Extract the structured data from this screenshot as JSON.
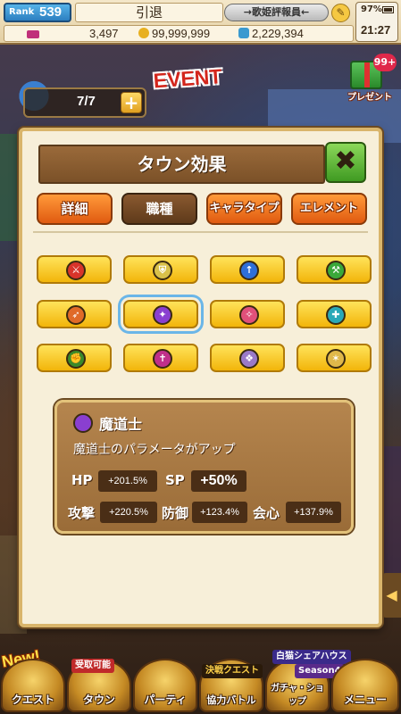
{
  "status": {
    "rank_label": "Rank",
    "rank_value": "539",
    "player_name": "引退",
    "title_badge": "→歌姫評報員←",
    "battery_pct": "97%",
    "clock": "21:27",
    "gems": "3,497",
    "gold": "99,999,999",
    "potion": "2,229,394"
  },
  "hud": {
    "stamina": "7/7",
    "stamina_plus": "+",
    "event_sign": "EVENT",
    "present_badge": "99+",
    "present_label": "プレゼント"
  },
  "panel": {
    "title": "タウン効果",
    "close_label": "✖",
    "tabs": [
      {
        "label": "詳細",
        "active": false
      },
      {
        "label": "職種",
        "active": true
      },
      {
        "label": "キャラタイプ",
        "active": false
      },
      {
        "label": "エレメント",
        "active": false
      }
    ],
    "classes": [
      {
        "icon": "swordsman-icon",
        "color": "#d8342a",
        "glyph": "⚔"
      },
      {
        "icon": "shield-knight-icon",
        "color": "#d9c14a",
        "glyph": "⛨"
      },
      {
        "icon": "lancer-icon",
        "color": "#2f6fd8",
        "glyph": "↑"
      },
      {
        "icon": "axe-icon",
        "color": "#3aa83a",
        "glyph": "⚒"
      },
      {
        "icon": "archer-icon",
        "color": "#e06a28",
        "glyph": "➶"
      },
      {
        "icon": "mage-icon",
        "color": "#8a3fd0",
        "glyph": "✦"
      },
      {
        "icon": "thief-icon",
        "color": "#e0507a",
        "glyph": "✧"
      },
      {
        "icon": "gunner-icon",
        "color": "#2aa8b8",
        "glyph": "✚"
      },
      {
        "icon": "fighter-icon",
        "color": "#3a8a2a",
        "glyph": "✊"
      },
      {
        "icon": "cleric-icon",
        "color": "#c0308a",
        "glyph": "✝"
      },
      {
        "icon": "dragon-icon",
        "color": "#9a7ac8",
        "glyph": "❖"
      },
      {
        "icon": "beast-icon",
        "color": "#e0b84a",
        "glyph": "✶"
      }
    ],
    "selected_index": 5,
    "detail": {
      "name": "魔道士",
      "description": "魔道士のパラメータがアップ",
      "hp_label": "HP",
      "hp_value": "+201.5%",
      "sp_label": "SP",
      "sp_value": "+50%",
      "atk_label": "攻撃",
      "atk_value": "+220.5%",
      "def_label": "防御",
      "def_value": "+123.4%",
      "crit_label": "会心",
      "crit_value": "+137.9%"
    }
  },
  "bottom_nav": {
    "new_tag": "New!",
    "items": [
      {
        "label": "クエスト"
      },
      {
        "label": "タウン",
        "tag": "受取可能"
      },
      {
        "label": "パーティ"
      },
      {
        "label": "協力バトル",
        "tag": "決戦クエスト"
      },
      {
        "label": "ガチャ・ショップ",
        "tag": "白猫シェアハウス",
        "subtag": "Season4"
      },
      {
        "label": "メニュー"
      }
    ]
  },
  "colors": {
    "accent_orange": "#e05a10",
    "tab_active": "#5e3a1a",
    "gold_button": "#f2b50a",
    "panel_bg": "#f7efd9"
  }
}
